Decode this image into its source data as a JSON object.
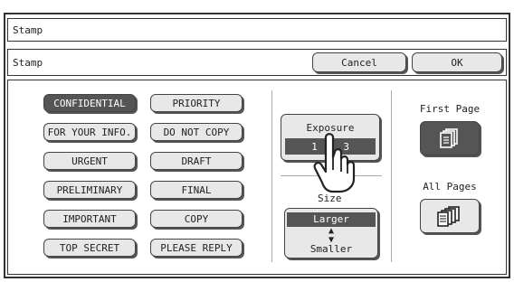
{
  "window": {
    "title": "Stamp"
  },
  "header": {
    "title": "Stamp",
    "cancel_label": "Cancel",
    "ok_label": "OK"
  },
  "stamps": [
    {
      "label": "CONFIDENTIAL",
      "selected": true
    },
    {
      "label": "PRIORITY",
      "selected": false
    },
    {
      "label": "FOR YOUR INFO.",
      "selected": false
    },
    {
      "label": "DO NOT COPY",
      "selected": false
    },
    {
      "label": "URGENT",
      "selected": false
    },
    {
      "label": "DRAFT",
      "selected": false
    },
    {
      "label": "PRELIMINARY",
      "selected": false
    },
    {
      "label": "FINAL",
      "selected": false
    },
    {
      "label": "IMPORTANT",
      "selected": false
    },
    {
      "label": "COPY",
      "selected": false
    },
    {
      "label": "TOP SECRET",
      "selected": false
    },
    {
      "label": "PLEASE REPLY",
      "selected": false
    }
  ],
  "exposure": {
    "label": "Exposure",
    "levels": [
      "1",
      "2",
      "3"
    ],
    "selected": "2"
  },
  "size": {
    "title": "Size",
    "larger_label": "Larger",
    "smaller_label": "Smaller"
  },
  "pages": {
    "first_page_label": "First Page",
    "first_page_selected": true,
    "all_pages_label": "All Pages",
    "all_pages_selected": false,
    "icon": "copy-stack-icon"
  },
  "pointer": {
    "icon": "hand-pointer-icon"
  },
  "colors": {
    "selected": "#555555",
    "button": "#e8e8e8",
    "border": "#333333"
  }
}
